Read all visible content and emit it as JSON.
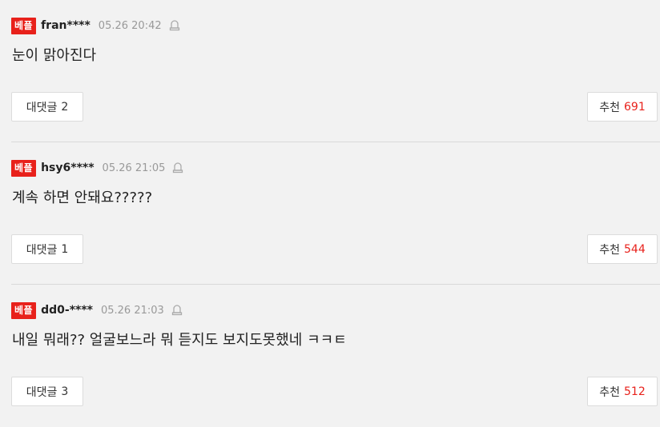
{
  "comments": [
    {
      "badge": "베플",
      "user": "fran****",
      "time": "05.26 20:42",
      "text": "눈이 맑아진다",
      "reply_label": "대댓글",
      "reply_count": "2",
      "rec_label": "추천",
      "rec_count": "691"
    },
    {
      "badge": "베플",
      "user": "hsy6****",
      "time": "05.26 21:05",
      "text": "계속 하면 안돼요?????",
      "reply_label": "대댓글",
      "reply_count": "1",
      "rec_label": "추천",
      "rec_count": "544"
    },
    {
      "badge": "베플",
      "user": "dd0-****",
      "time": "05.26 21:03",
      "text": "내일 뭐래?? 얼굴보느라 뭐 듣지도 보지도못했네 ㅋㅋㅌ",
      "reply_label": "대댓글",
      "reply_count": "3",
      "rec_label": "추천",
      "rec_count": "512"
    }
  ],
  "icons": {
    "report": "bell-icon"
  },
  "colors": {
    "accent": "#e8211b",
    "background": "#f2f2f2",
    "muted": "#999999"
  }
}
